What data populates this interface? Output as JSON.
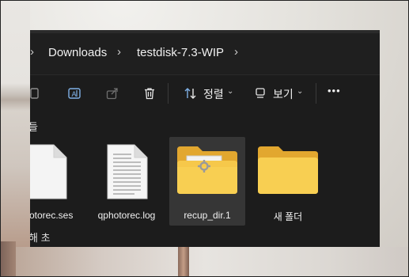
{
  "breadcrumb": {
    "items": [
      {
        "label": "Downloads"
      },
      {
        "label": "testdisk-7.3-WIP"
      }
    ]
  },
  "toolbar": {
    "sort_label": "정렬",
    "view_label": "보기",
    "more_label": "•••"
  },
  "groups": {
    "first_label": "들",
    "second_label": "해 초"
  },
  "files": [
    {
      "name": "photorec.ses",
      "icon": "document-icon"
    },
    {
      "name": "qphotorec.log",
      "icon": "text-document-icon"
    },
    {
      "name": "recup_dir.1",
      "icon": "folder-with-file-icon",
      "selected": true
    },
    {
      "name": "새 폴더",
      "icon": "folder-icon"
    }
  ],
  "colors": {
    "window_bg": "#1c1c1c",
    "folder_front": "#f8cf52",
    "folder_back": "#e2a72f",
    "selection": "#363636"
  }
}
